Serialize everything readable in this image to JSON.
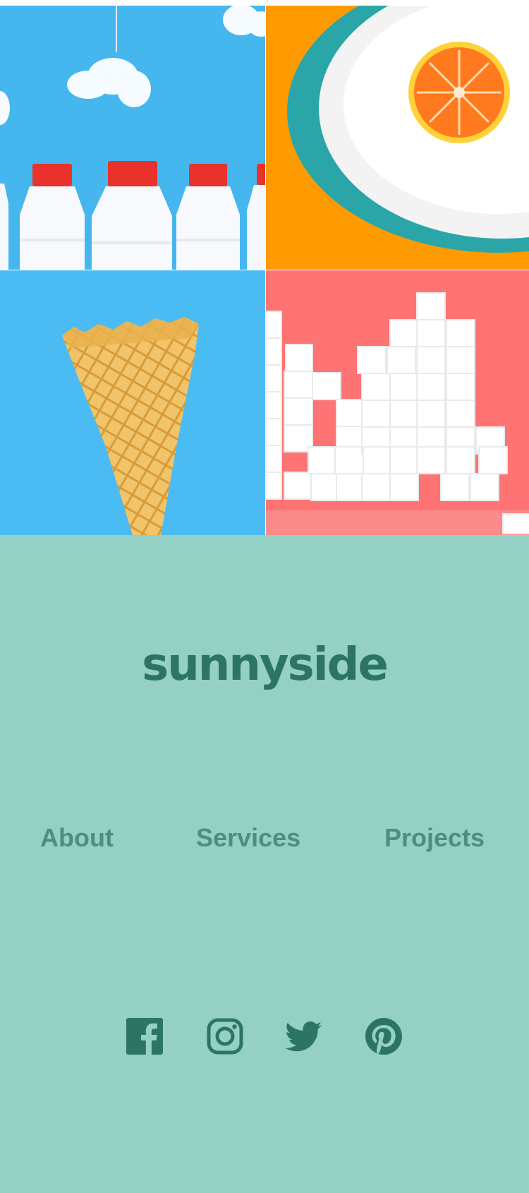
{
  "brand": {
    "logo_text": "sunnyside"
  },
  "gallery": {
    "items": [
      {
        "subject": "milk-bottles",
        "background": "#45b6ee"
      },
      {
        "subject": "orange-on-plate",
        "background": "#ff9b00"
      },
      {
        "subject": "ice-cream-cone",
        "background": "#4bbcf3"
      },
      {
        "subject": "sugar-cubes",
        "background": "#fe7373"
      }
    ]
  },
  "footer": {
    "background": "#94d1c4",
    "logo_color": "#2c7566",
    "nav": {
      "about": "About",
      "services": "Services",
      "projects": "Projects",
      "link_color": "#4e8e80"
    },
    "social": {
      "icons": [
        "facebook-icon",
        "instagram-icon",
        "twitter-icon",
        "pinterest-icon"
      ],
      "icon_color": "#2c7566"
    }
  }
}
